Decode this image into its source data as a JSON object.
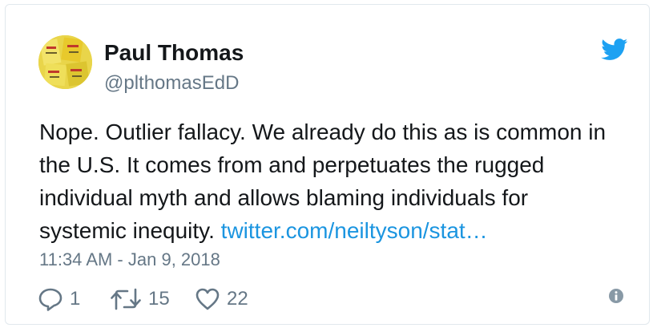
{
  "tweet": {
    "author_name": "Paul Thomas",
    "author_handle": "@plthomasEdD",
    "text_lines": [
      "Nope. Outlier fallacy. We already do this as is common in",
      "the U.S. It comes from and perpetuates the rugged",
      "individual myth and allows blaming individuals for",
      "systemic inequity. "
    ],
    "link_text": "twitter.com/neiltyson/stat…",
    "timestamp": "11:34 AM - Jan 9, 2018"
  },
  "actions": {
    "reply_count": "1",
    "retweet_count": "15",
    "like_count": "22"
  },
  "icons": {
    "brand": "twitter-bird-icon",
    "reply": "reply-icon",
    "retweet": "retweet-icon",
    "like": "heart-icon",
    "info": "info-icon"
  },
  "colors": {
    "brand_blue": "#1da1f2",
    "link_blue": "#1b95e0",
    "text": "#14171a",
    "secondary": "#657786",
    "border": "#e1e8ed"
  }
}
